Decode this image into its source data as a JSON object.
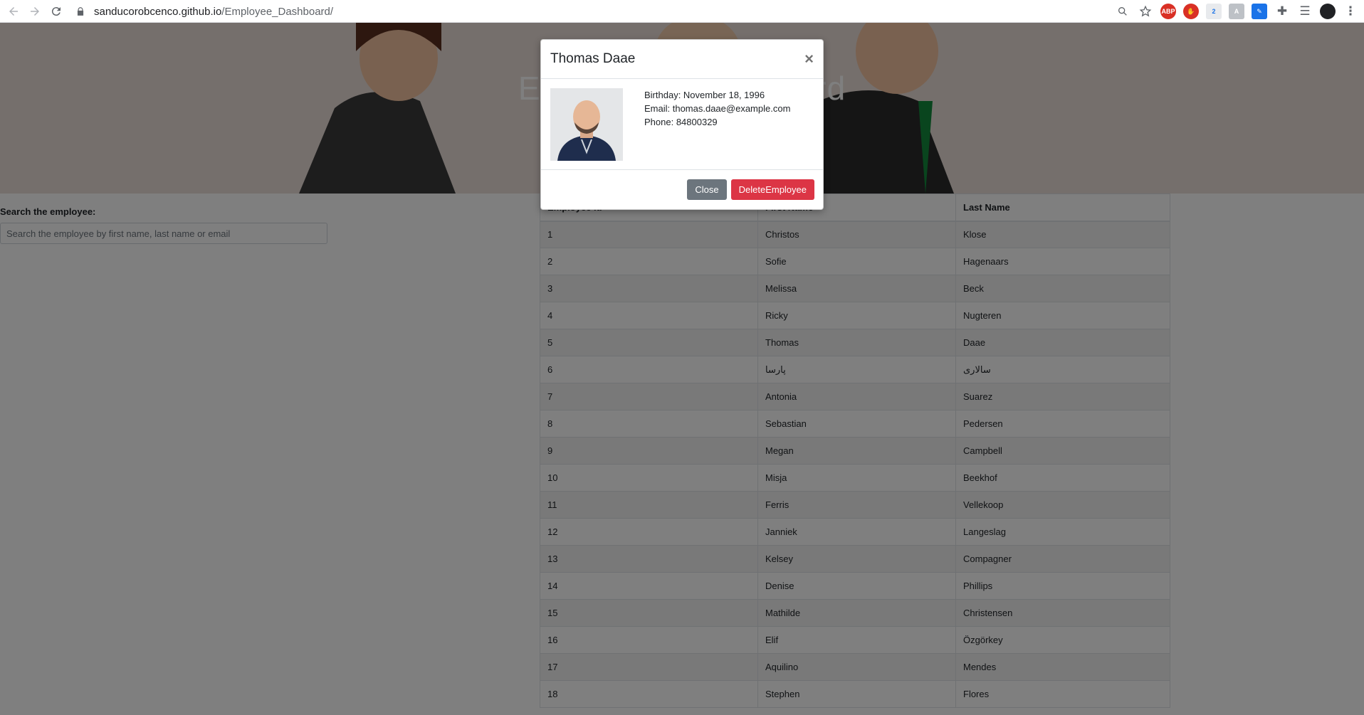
{
  "browser": {
    "url_host": "sanducorobcenco.github.io",
    "url_path": "/Employee_Dashboard/"
  },
  "hero": {
    "title": "Employee Dashboard"
  },
  "search": {
    "label": "Search the employee:",
    "placeholder": "Search the employee by first name, last name or email"
  },
  "table": {
    "headers": [
      "Employee id",
      "First Name",
      "Last Name"
    ],
    "rows": [
      [
        "1",
        "Christos",
        "Klose"
      ],
      [
        "2",
        "Sofie",
        "Hagenaars"
      ],
      [
        "3",
        "Melissa",
        "Beck"
      ],
      [
        "4",
        "Ricky",
        "Nugteren"
      ],
      [
        "5",
        "Thomas",
        "Daae"
      ],
      [
        "6",
        "پارسا",
        "سالاری"
      ],
      [
        "7",
        "Antonia",
        "Suarez"
      ],
      [
        "8",
        "Sebastian",
        "Pedersen"
      ],
      [
        "9",
        "Megan",
        "Campbell"
      ],
      [
        "10",
        "Misja",
        "Beekhof"
      ],
      [
        "11",
        "Ferris",
        "Vellekoop"
      ],
      [
        "12",
        "Janniek",
        "Langeslag"
      ],
      [
        "13",
        "Kelsey",
        "Compagner"
      ],
      [
        "14",
        "Denise",
        "Phillips"
      ],
      [
        "15",
        "Mathilde",
        "Christensen"
      ],
      [
        "16",
        "Elif",
        "Özgörkey"
      ],
      [
        "17",
        "Aquilino",
        "Mendes"
      ],
      [
        "18",
        "Stephen",
        "Flores"
      ]
    ]
  },
  "modal": {
    "title": "Thomas Daae",
    "close_symbol": "×",
    "birthday": "Birthday: November 18, 1996",
    "email": "Email: thomas.daae@example.com",
    "phone": "Phone: 84800329",
    "close_label": "Close",
    "delete_label": "DeleteEmployee"
  },
  "colors": {
    "danger": "#dc3545",
    "secondary": "#6c757d"
  }
}
